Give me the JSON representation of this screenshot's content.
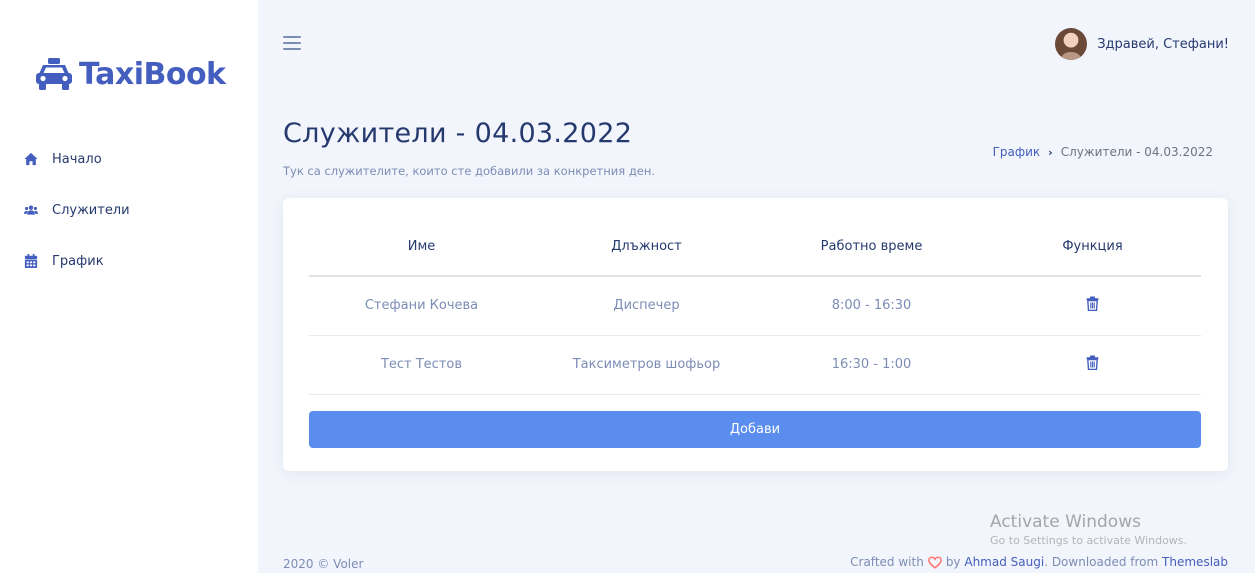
{
  "app": {
    "name": "TaxiBook"
  },
  "sidebar": {
    "items": [
      {
        "label": "Начало",
        "icon": "home-icon"
      },
      {
        "label": "Служители",
        "icon": "users-icon"
      },
      {
        "label": "График",
        "icon": "calendar-icon"
      }
    ]
  },
  "topbar": {
    "greeting": "Здравей, Стефани!"
  },
  "page": {
    "title": "Служители - 04.03.2022",
    "subtitle": "Тук са служителите, които сте добавили за конкретния ден.",
    "breadcrumb": {
      "link": "График",
      "current": "Служители - 04.03.2022"
    }
  },
  "table": {
    "headers": [
      "Име",
      "Длъжност",
      "Работно време",
      "Функция"
    ],
    "rows": [
      {
        "name": "Стефани Кочева",
        "position": "Диспечер",
        "hours": "8:00 - 16:30"
      },
      {
        "name": "Тест Тестов",
        "position": "Таксиметров шофьор",
        "hours": "16:30 - 1:00"
      }
    ]
  },
  "actions": {
    "add_label": "Добави"
  },
  "footer": {
    "left": "2020 © Voler",
    "crafted": "Crafted with",
    "by": "by",
    "author": "Ahmad Saugi",
    "downloaded": ". Downloaded from",
    "source": "Themeslab"
  },
  "watermark": {
    "title": "Activate Windows",
    "subtitle": "Go to Settings to activate Windows."
  },
  "colors": {
    "accent": "#435ebe",
    "button": "#5a8dee",
    "heading": "#25396f",
    "heart": "#ff7976"
  }
}
